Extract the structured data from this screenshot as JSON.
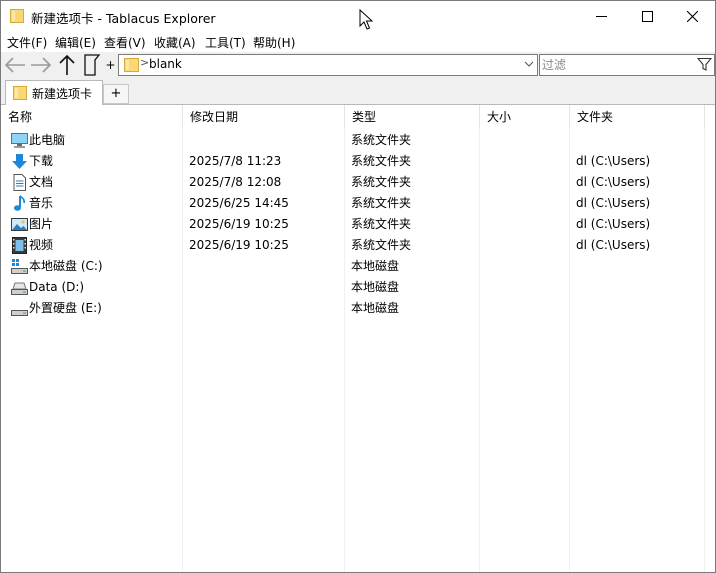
{
  "window": {
    "title": "新建选项卡 - Tablacus Explorer"
  },
  "menubar": {
    "items": [
      "文件(F)",
      "编辑(E)",
      "查看(V)",
      "收藏(A)",
      "工具(T)",
      "帮助(H)"
    ]
  },
  "toolbar": {
    "plus_label": "+",
    "address": {
      "separator": ">",
      "path": "blank"
    },
    "filter_placeholder": "过滤"
  },
  "tabs": {
    "items": [
      {
        "label": "新建选项卡"
      }
    ],
    "add_label": "+"
  },
  "list": {
    "columns": [
      "名称",
      "修改日期",
      "类型",
      "大小",
      "文件夹"
    ],
    "rows": [
      {
        "icon": "computer-icon",
        "name": "此电脑",
        "date": "",
        "type": "系统文件夹",
        "size": "",
        "folder": ""
      },
      {
        "icon": "download-icon",
        "name": "下载",
        "date": "2025/7/8 11:23",
        "type": "系统文件夹",
        "size": "",
        "folder": "dl (C:\\Users)"
      },
      {
        "icon": "document-icon",
        "name": "文档",
        "date": "2025/7/8 12:08",
        "type": "系统文件夹",
        "size": "",
        "folder": "dl (C:\\Users)"
      },
      {
        "icon": "music-icon",
        "name": "音乐",
        "date": "2025/6/25 14:45",
        "type": "系统文件夹",
        "size": "",
        "folder": "dl (C:\\Users)"
      },
      {
        "icon": "picture-icon",
        "name": "图片",
        "date": "2025/6/19 10:25",
        "type": "系统文件夹",
        "size": "",
        "folder": "dl (C:\\Users)"
      },
      {
        "icon": "video-icon",
        "name": "视频",
        "date": "2025/6/19 10:25",
        "type": "系统文件夹",
        "size": "",
        "folder": "dl (C:\\Users)"
      },
      {
        "icon": "system-drive-icon",
        "name": "本地磁盘 (C:)",
        "date": "",
        "type": "本地磁盘",
        "size": "",
        "folder": ""
      },
      {
        "icon": "drive-icon",
        "name": "Data (D:)",
        "date": "",
        "type": "本地磁盘",
        "size": "",
        "folder": ""
      },
      {
        "icon": "drive-icon",
        "name": "外置硬盘 (E:)",
        "date": "",
        "type": "本地磁盘",
        "size": "",
        "folder": ""
      }
    ]
  },
  "colors": {
    "folder_yellow": "#f8d775",
    "toolbar_bg": "#f0f0f0",
    "border": "#7a7a7a",
    "icon_blue": "#1e88d8"
  }
}
